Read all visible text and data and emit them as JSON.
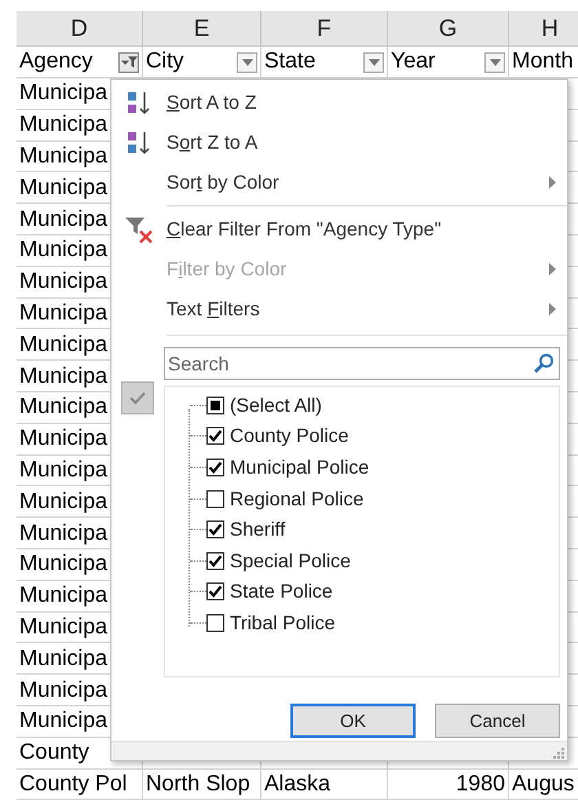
{
  "column_letters": [
    "D",
    "E",
    "F",
    "G",
    "H"
  ],
  "header_cells": [
    {
      "label": "Agency",
      "filtered": true
    },
    {
      "label": "City",
      "filtered": false
    },
    {
      "label": "State",
      "filtered": false
    },
    {
      "label": "Year",
      "filtered": false
    },
    {
      "label": "Month"
    }
  ],
  "rows": [
    [
      "Municipa",
      "",
      "",
      "",
      ""
    ],
    [
      "Municipa",
      "",
      "",
      "",
      ""
    ],
    [
      "Municipa",
      "",
      "",
      "",
      ""
    ],
    [
      "Municipa",
      "",
      "",
      "",
      ""
    ],
    [
      "Municipa",
      "",
      "",
      "",
      ""
    ],
    [
      "Municipa",
      "",
      "",
      "",
      ""
    ],
    [
      "Municipa",
      "",
      "",
      "",
      ""
    ],
    [
      "Municipa",
      "",
      "",
      "",
      ""
    ],
    [
      "Municipa",
      "",
      "",
      "",
      ""
    ],
    [
      "Municipa",
      "",
      "",
      "",
      ""
    ],
    [
      "Municipa",
      "",
      "",
      "",
      ""
    ],
    [
      "Municipa",
      "",
      "",
      "",
      ""
    ],
    [
      "Municipa",
      "",
      "",
      "",
      ""
    ],
    [
      "Municipa",
      "",
      "",
      "",
      ""
    ],
    [
      "Municipa",
      "",
      "",
      "",
      ""
    ],
    [
      "Municipa",
      "",
      "",
      "",
      ""
    ],
    [
      "Municipa",
      "",
      "",
      "",
      ""
    ],
    [
      "Municipa",
      "",
      "",
      "",
      ""
    ],
    [
      "Municipa",
      "",
      "",
      "",
      ""
    ],
    [
      "Municipa",
      "",
      "",
      "",
      ""
    ],
    [
      "Municipa",
      "",
      "",
      "",
      ""
    ],
    [
      "County",
      "",
      "",
      "",
      ""
    ],
    [
      "County Pol",
      "North Slop",
      "Alaska",
      "1980",
      "Augus"
    ]
  ],
  "filter_menu": {
    "items": [
      {
        "kind": "sort-asc",
        "key": "S",
        "after": "ort A to Z",
        "disabled": false,
        "submenu": false
      },
      {
        "kind": "sort-desc",
        "before": "S",
        "key": "o",
        "after": "rt Z to A",
        "disabled": false,
        "submenu": false
      },
      {
        "kind": "plain",
        "before": "Sor",
        "key": "t",
        "after": " by Color",
        "disabled": false,
        "submenu": true
      },
      {
        "kind": "divider"
      },
      {
        "kind": "clear-filter",
        "key": "C",
        "after": "lear Filter From \"Agency Type\"",
        "disabled": false,
        "submenu": false
      },
      {
        "kind": "plain",
        "before": "F",
        "key": "i",
        "after": "lter by Color",
        "disabled": true,
        "submenu": true
      },
      {
        "kind": "plain",
        "before": "Text ",
        "key": "F",
        "after": "ilters",
        "disabled": false,
        "submenu": true
      }
    ],
    "search": {
      "placeholder": "Search"
    },
    "values": [
      {
        "label": "(Select All)",
        "indeterminate": true
      },
      {
        "label": "County Police",
        "checked": true
      },
      {
        "label": "Municipal Police",
        "checked": true
      },
      {
        "label": "Regional Police",
        "checked": false
      },
      {
        "label": "Sheriff",
        "checked": true
      },
      {
        "label": "Special Police",
        "checked": true
      },
      {
        "label": "State Police",
        "checked": true
      },
      {
        "label": "Tribal Police",
        "checked": false
      }
    ],
    "buttons": [
      {
        "label": "OK",
        "default": true
      },
      {
        "label": "Cancel",
        "default": false
      }
    ]
  }
}
